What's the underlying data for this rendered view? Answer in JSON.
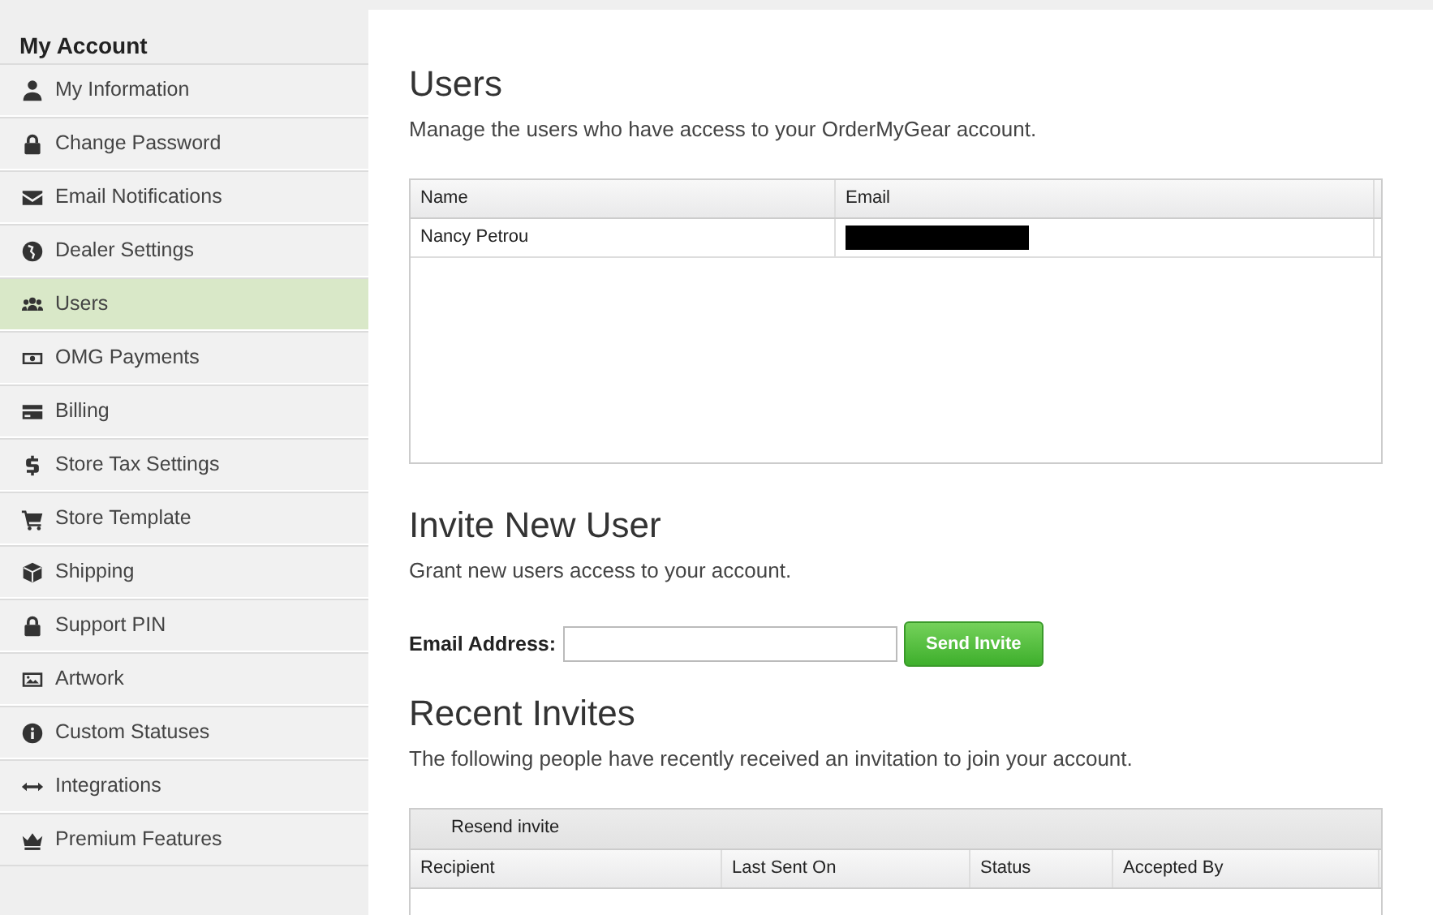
{
  "sidebar": {
    "title": "My Account",
    "items": [
      {
        "label": "My Information",
        "selected": false
      },
      {
        "label": "Change Password",
        "selected": false
      },
      {
        "label": "Email Notifications",
        "selected": false
      },
      {
        "label": "Dealer Settings",
        "selected": false
      },
      {
        "label": "Users",
        "selected": true
      },
      {
        "label": "OMG Payments",
        "selected": false
      },
      {
        "label": "Billing",
        "selected": false
      },
      {
        "label": "Store Tax Settings",
        "selected": false
      },
      {
        "label": "Store Template",
        "selected": false
      },
      {
        "label": "Shipping",
        "selected": false
      },
      {
        "label": "Support PIN",
        "selected": false
      },
      {
        "label": "Artwork",
        "selected": false
      },
      {
        "label": "Custom Statuses",
        "selected": false
      },
      {
        "label": "Integrations",
        "selected": false
      },
      {
        "label": "Premium Features",
        "selected": false
      }
    ]
  },
  "users": {
    "title": "Users",
    "description": "Manage the users who have access to your OrderMyGear account.",
    "columns": [
      "Name",
      "Email"
    ],
    "rows": [
      {
        "name": "Nancy Petrou",
        "email_redacted": true
      }
    ]
  },
  "invite": {
    "title": "Invite New User",
    "description": "Grant new users access to your account.",
    "field_label": "Email Address:",
    "button": "Send Invite"
  },
  "recent": {
    "title": "Recent Invites",
    "description": "The following people have recently received an invitation to join your account.",
    "toolbar_button": "Resend invite",
    "columns": [
      "Recipient",
      "Last Sent On",
      "Status",
      "Accepted By"
    ]
  }
}
